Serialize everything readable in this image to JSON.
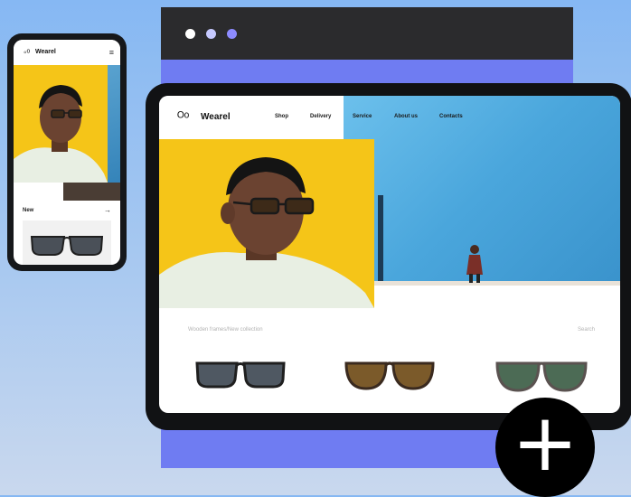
{
  "brand": "Wearel",
  "nav": [
    "Shop",
    "Delivery",
    "Service",
    "About us",
    "Contacts"
  ],
  "phone": {
    "brand": "Wearel",
    "section_title": "New",
    "arrow_icon": "arrow-right-icon",
    "menu_icon": "hamburger-menu-icon"
  },
  "tablet": {
    "collection_label": "Wooden frames/New collection",
    "search_label": "Search"
  },
  "browser": {
    "dots": [
      "#ffffff",
      "#c6c9ff",
      "#8d8bff"
    ]
  },
  "plus_button": {
    "label": "+",
    "icon": "plus-icon"
  },
  "colors": {
    "accent_yellow": "#f5c518",
    "browser_purple": "#6f7cf2",
    "sky_blue": "#4aa6dc"
  }
}
